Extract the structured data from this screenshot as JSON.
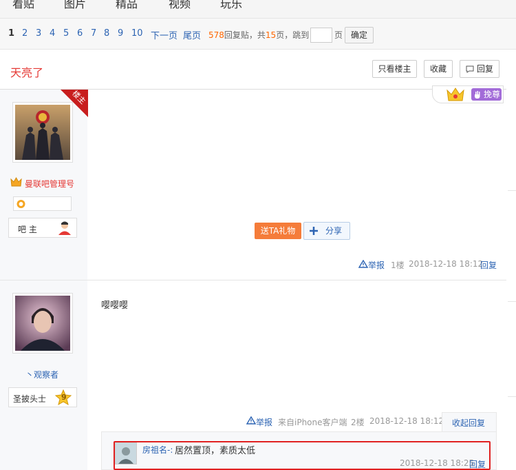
{
  "nav": {
    "tabs": [
      "看贴",
      "图片",
      "精品",
      "视频",
      "玩乐"
    ]
  },
  "pager": {
    "pages": [
      "1",
      "2",
      "3",
      "4",
      "5",
      "6",
      "7",
      "8",
      "9",
      "10"
    ],
    "next": "下一页",
    "last": "尾页",
    "reply_count": "578",
    "reply_label": "回复贴，共",
    "total_pages": "15",
    "pages_label": "页，跳到",
    "page_unit": "页",
    "confirm": "确定"
  },
  "thread": {
    "title": "天亮了",
    "only_op": "只看楼主",
    "favorite": "收藏",
    "reply": "回复",
    "crown_label": "挽尊"
  },
  "floor1": {
    "op_badge": "楼主",
    "username": "曼联吧管理号",
    "role": "吧 主",
    "gift": "送TA礼物",
    "share": "分享",
    "report": "举报",
    "floor": "1楼",
    "time": "2018-12-18 18:12",
    "reply": "回复"
  },
  "floor2": {
    "content": "嘤嘤嘤",
    "username": "丶观察者",
    "title": "圣披头士",
    "level": "9",
    "report": "举报",
    "source": "来自iPhone客户端",
    "floor": "2楼",
    "time": "2018-12-18 18:12",
    "collapse": "收起回复",
    "sub_reply": {
      "user": "房祖名-:",
      "text": "居然置顶，素质太低",
      "time": "2018-12-18 18:25",
      "reply": "回复"
    }
  },
  "colors": {
    "accent_red": "#e53935",
    "link_blue": "#2d64b3",
    "gift_orange": "#f57c3a",
    "highlight": "#e02020"
  }
}
